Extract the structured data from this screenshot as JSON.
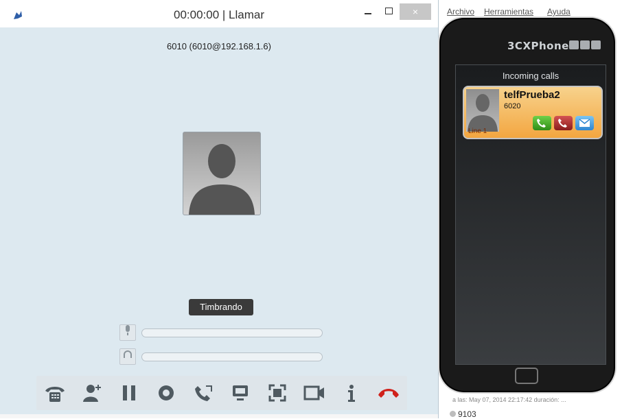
{
  "call_window": {
    "title": "00:00:00 | Llamar",
    "contact_line": "6010 (6010@192.168.1.6)",
    "status": "Timbrando",
    "controls": {
      "close_symbol": "×"
    },
    "toolbar": [
      {
        "icon": "dialpad-phone-icon"
      },
      {
        "icon": "add-contact-icon"
      },
      {
        "icon": "pause-icon"
      },
      {
        "icon": "record-icon"
      },
      {
        "icon": "transfer-call-icon"
      },
      {
        "icon": "screen-share-icon"
      },
      {
        "icon": "fullscreen-icon"
      },
      {
        "icon": "video-camera-icon"
      },
      {
        "icon": "info-icon"
      },
      {
        "icon": "hang-up-icon",
        "color": "#d0221c"
      }
    ]
  },
  "cx_window": {
    "menu": [
      "Archivo",
      "Herramientas",
      "Ayuda"
    ],
    "brand": "3CXPhone",
    "incoming_label": "Incoming calls",
    "call": {
      "name": "telfPrueba2",
      "number": "6020",
      "line": "Line 1"
    },
    "history": {
      "line1": "a las: May 07, 2014 22:17:42 duración: ...",
      "line2": "9103"
    }
  }
}
